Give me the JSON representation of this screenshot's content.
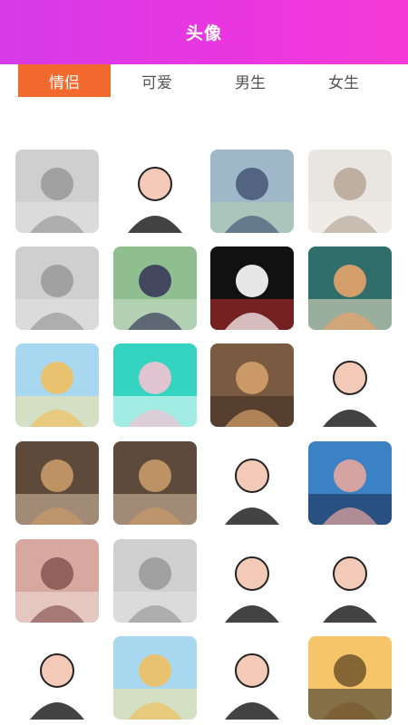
{
  "header": {
    "title": "头像"
  },
  "tabs": [
    {
      "label": "情侣",
      "active": true
    },
    {
      "label": "可爱",
      "active": false
    },
    {
      "label": "男生",
      "active": false
    },
    {
      "label": "女生",
      "active": false
    }
  ],
  "colors": {
    "header_start": "#d63be8",
    "header_end": "#f53ad8",
    "active_tab": "#f26a2e"
  },
  "avatars": [
    {
      "name": "avatar-blurry-boy-portrait",
      "style": "photo-gray"
    },
    {
      "name": "avatar-cartoon-girl-red-hat",
      "style": "cartoon-white"
    },
    {
      "name": "avatar-anime-boy-hydrangeas",
      "style": "anime-blue"
    },
    {
      "name": "avatar-girl-covering-eyes",
      "style": "photo-light"
    },
    {
      "name": "avatar-boy-hand-on-face",
      "style": "photo-gray"
    },
    {
      "name": "avatar-anime-girl-umbrella",
      "style": "anime-green"
    },
    {
      "name": "avatar-anime-white-hair-boy",
      "style": "bw"
    },
    {
      "name": "avatar-cartoon-girl-glasses",
      "style": "cartoon-teal"
    },
    {
      "name": "avatar-anime-boy-rainbow",
      "style": "anime-pastel"
    },
    {
      "name": "avatar-cartoon-cat-teal",
      "style": "cartoon-teal-bright"
    },
    {
      "name": "avatar-girl-night-lights",
      "style": "photo-warm"
    },
    {
      "name": "avatar-cartoon-old-man",
      "style": "cartoon-white"
    },
    {
      "name": "avatar-boy-street-night-1",
      "style": "photo-street"
    },
    {
      "name": "avatar-boy-street-night-2",
      "style": "photo-street"
    },
    {
      "name": "avatar-sketch-boy-glasses",
      "style": "cartoon-white"
    },
    {
      "name": "avatar-cartoon-weightlifter",
      "style": "cartoon-blue"
    },
    {
      "name": "avatar-girl-red-tint",
      "style": "photo-red"
    },
    {
      "name": "avatar-girl-red-bag",
      "style": "photo-gray"
    },
    {
      "name": "avatar-cartoon-dark-hair-girl",
      "style": "cartoon-white"
    },
    {
      "name": "avatar-cartoon-blue-headband",
      "style": "cartoon-white"
    },
    {
      "name": "avatar-boy-triangle-art",
      "style": "cartoon-white"
    },
    {
      "name": "avatar-anime-girl-rainbow",
      "style": "anime-pastel"
    },
    {
      "name": "avatar-sketch-boy-cap",
      "style": "cartoon-white"
    },
    {
      "name": "avatar-sunset-couple",
      "style": "photo-sunset"
    }
  ]
}
